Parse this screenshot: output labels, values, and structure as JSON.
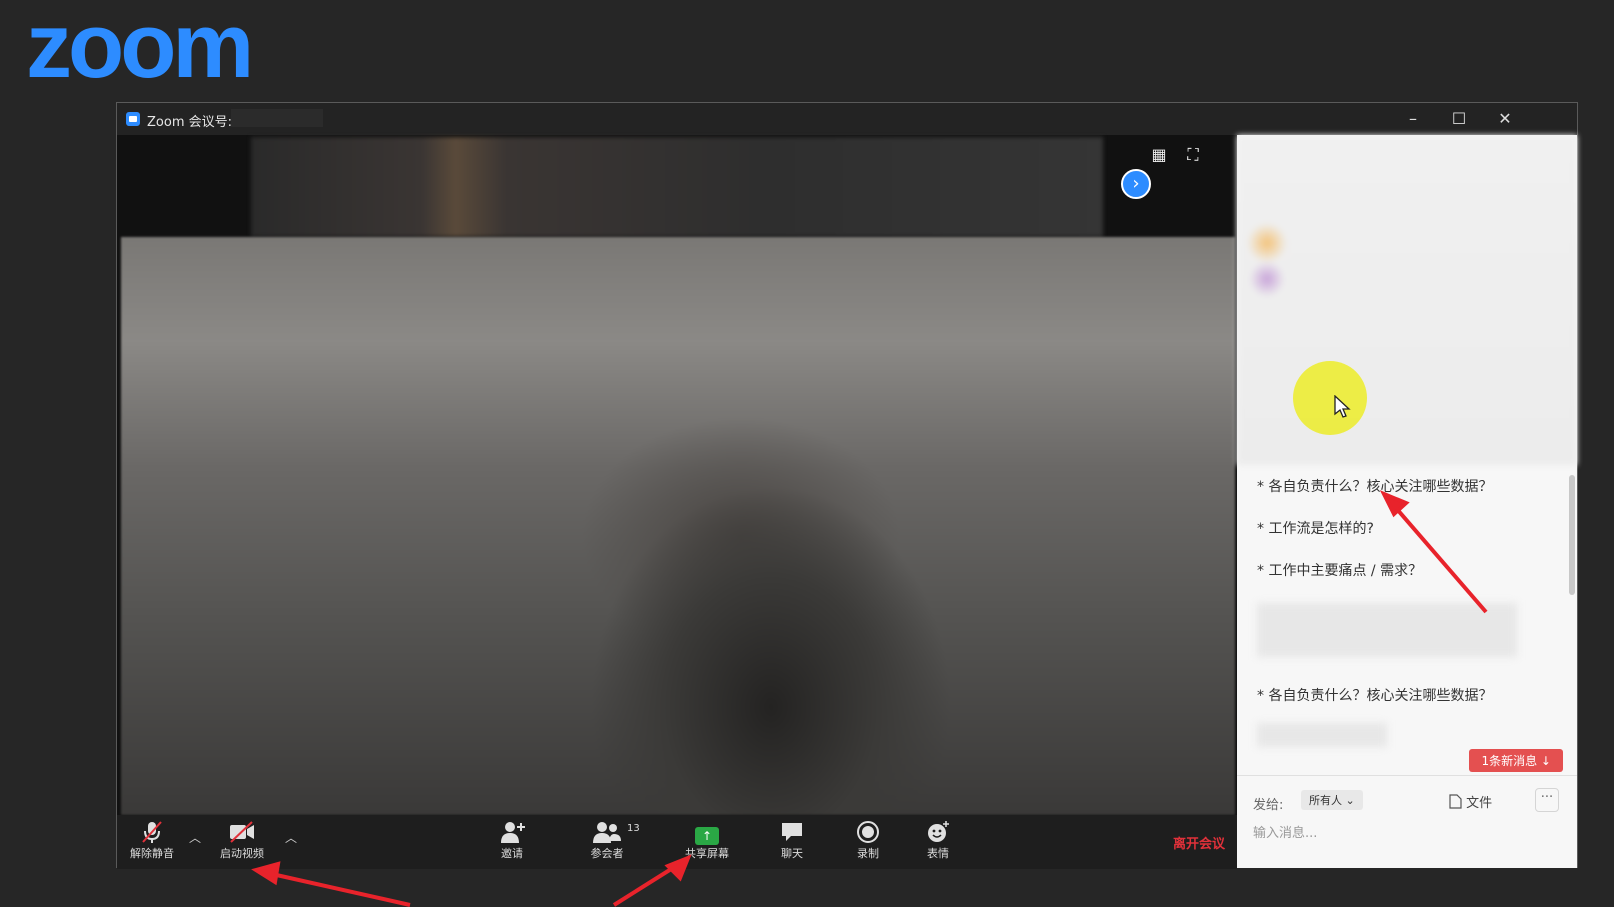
{
  "brand": {
    "logo_text": "zoom"
  },
  "window": {
    "title": "Zoom 会议号:",
    "controls": {
      "minimize": "–",
      "maximize": "☐",
      "close": "✕"
    }
  },
  "video": {
    "next_page": "›",
    "gallery_view": "▦",
    "fullscreen": "⛶"
  },
  "toolbar": {
    "unmute": "解除静音",
    "start_video": "启动视频",
    "invite": "邀请",
    "participants": "参会者",
    "participants_count": "13",
    "share_screen": "共享屏幕",
    "chat": "聊天",
    "record": "录制",
    "reactions": "表情",
    "leave": "离开会议",
    "caret": "︿"
  },
  "chat": {
    "messages": [
      "* 各自负责什么？核心关注哪些数据？",
      "* 工作流是怎样的?",
      "* 工作中主要痛点 / 需求？",
      "* 各自负责什么？核心关注哪些数据？"
    ],
    "new_message_badge": "1条新消息 ↓",
    "send_to_label": "发给:",
    "send_to_value": "所有人 ⌄",
    "file_label": "文件",
    "more_label": "···",
    "input_placeholder": "输入消息..."
  },
  "colors": {
    "brand_blue": "#2d8cff",
    "leave_red": "#e1313a",
    "share_green": "#2aa845",
    "annotation_red": "#e8232b",
    "badge_red": "#e45050"
  }
}
